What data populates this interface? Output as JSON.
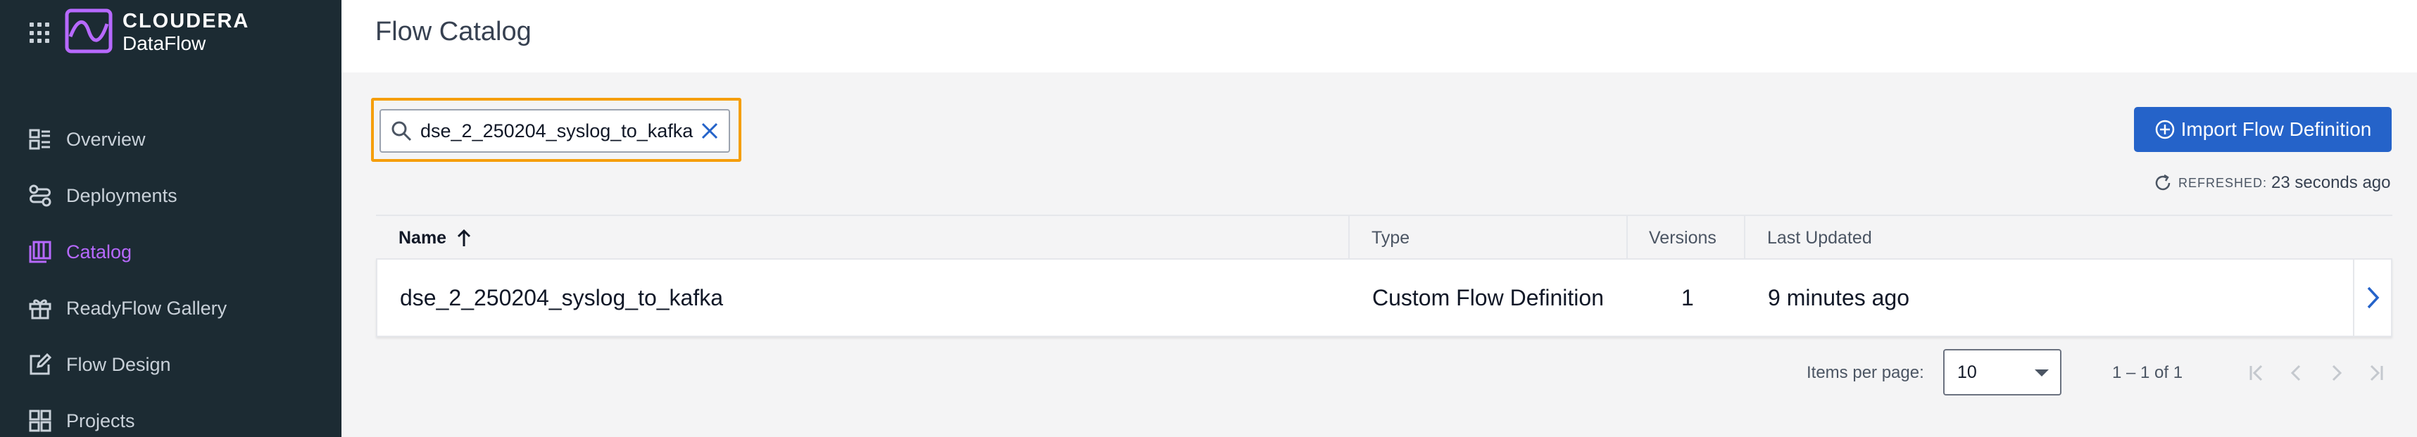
{
  "brand": {
    "line1": "CLOUDERA",
    "line2": "DataFlow",
    "accent": "#b769ff"
  },
  "sidebar": {
    "items": [
      {
        "label": "Overview",
        "icon": "overview-icon",
        "active": false
      },
      {
        "label": "Deployments",
        "icon": "deployments-icon",
        "active": false
      },
      {
        "label": "Catalog",
        "icon": "catalog-icon",
        "active": true
      },
      {
        "label": "ReadyFlow Gallery",
        "icon": "gift-icon",
        "active": false
      },
      {
        "label": "Flow Design",
        "icon": "edit-icon",
        "active": false
      },
      {
        "label": "Projects",
        "icon": "projects-icon",
        "active": false
      }
    ]
  },
  "header": {
    "title": "Flow Catalog"
  },
  "search": {
    "value": "dse_2_250204_syslog_to_kafka"
  },
  "toolbar": {
    "import_label": "Import Flow Definition"
  },
  "refresh": {
    "label": "REFRESHED:",
    "value": "23 seconds ago"
  },
  "table": {
    "columns": {
      "name": "Name",
      "type": "Type",
      "versions": "Versions",
      "updated": "Last Updated"
    },
    "rows": [
      {
        "name": "dse_2_250204_syslog_to_kafka",
        "type": "Custom Flow Definition",
        "versions": "1",
        "updated": "9 minutes ago"
      }
    ]
  },
  "pagination": {
    "items_per_page_label": "Items per page:",
    "items_per_page": "10",
    "range": "1 – 1 of 1"
  },
  "colors": {
    "sidebar_bg": "#1c2b33",
    "primary": "#2563c9",
    "highlight": "#f59e0b"
  }
}
